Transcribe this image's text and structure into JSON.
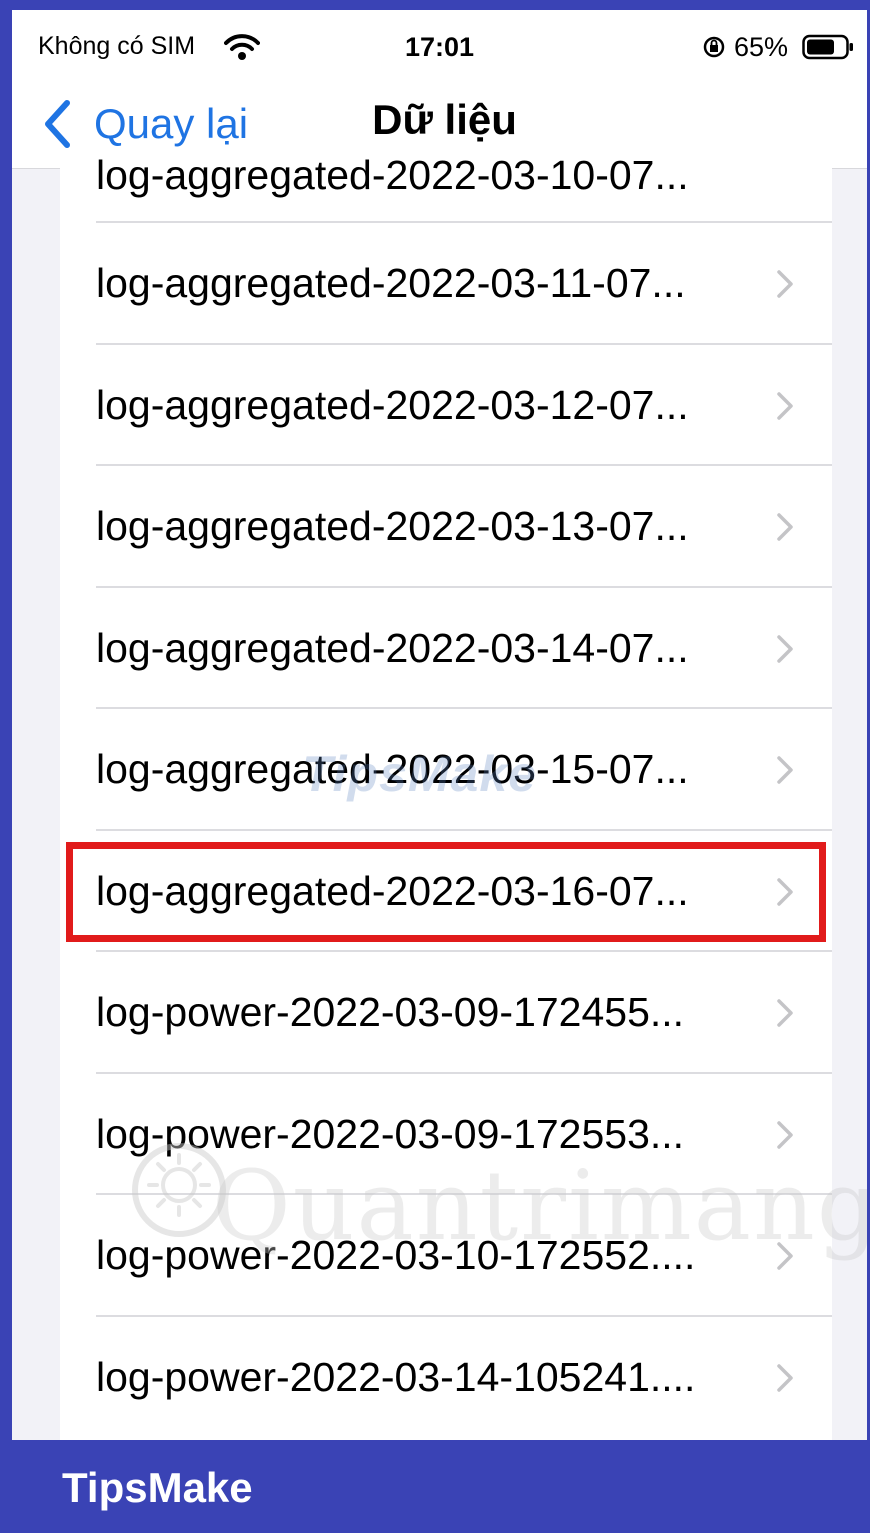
{
  "status_bar": {
    "carrier": "Không có SIM",
    "time": "17:01",
    "battery_percent": "65%",
    "icons": [
      "wifi-icon",
      "lock-rotation-icon",
      "battery-icon"
    ]
  },
  "nav_bar": {
    "back_label": "Quay lại",
    "title": "Dữ liệu"
  },
  "list": {
    "partial_top_item": "log-aggregated-2022-03-10-07...",
    "items": [
      {
        "label": "log-aggregated-2022-03-11-07...",
        "highlighted": false
      },
      {
        "label": "log-aggregated-2022-03-12-07...",
        "highlighted": false
      },
      {
        "label": "log-aggregated-2022-03-13-07...",
        "highlighted": false
      },
      {
        "label": "log-aggregated-2022-03-14-07...",
        "highlighted": false
      },
      {
        "label": "log-aggregated-2022-03-15-07...",
        "highlighted": false
      },
      {
        "label": "log-aggregated-2022-03-16-07...",
        "highlighted": true
      },
      {
        "label": "log-power-2022-03-09-172455...",
        "highlighted": false
      },
      {
        "label": "log-power-2022-03-09-172553...",
        "highlighted": false
      },
      {
        "label": "log-power-2022-03-10-172552....",
        "highlighted": false
      },
      {
        "label": "log-power-2022-03-14-105241....",
        "highlighted": false
      }
    ]
  },
  "watermarks": {
    "tipsmake": "TipsMake",
    "quantrimang": "Quantrimang"
  },
  "footer": {
    "brand": "TipsMake"
  },
  "colors": {
    "accent": "#1f74e3",
    "highlight": "#e11b1b",
    "frame": "#3a43b5"
  }
}
